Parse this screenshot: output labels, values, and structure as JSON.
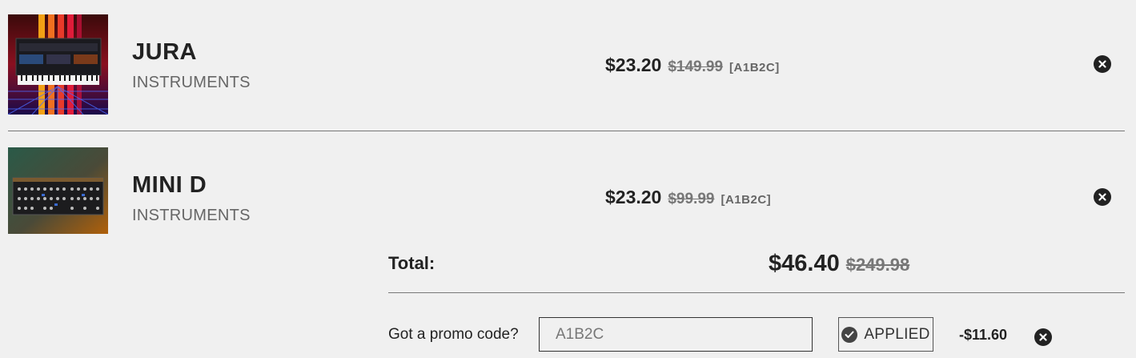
{
  "cart": {
    "items": [
      {
        "name": "JURA",
        "category": "INSTRUMENTS",
        "price": "$23.20",
        "original_price": "$149.99",
        "code": "[A1B2C]",
        "thumbnail_icon": "synth-thumbnail-sunset"
      },
      {
        "name": "MINI D",
        "category": "INSTRUMENTS",
        "price": "$23.20",
        "original_price": "$99.99",
        "code": "[A1B2C]",
        "thumbnail_icon": "synth-thumbnail-panel"
      }
    ],
    "total": {
      "label": "Total:",
      "price": "$46.40",
      "original_price": "$249.98"
    },
    "promo": {
      "label": "Got a promo code?",
      "value": "A1B2C",
      "status_label": "APPLIED",
      "discount": "-$11.60"
    }
  },
  "colors": {
    "background": "#f0f0f0",
    "text": "#222222",
    "muted": "#666666",
    "strike": "#777777",
    "divider": "#777777"
  },
  "icons": {
    "remove": "close-circle-icon",
    "applied": "check-circle-icon"
  }
}
